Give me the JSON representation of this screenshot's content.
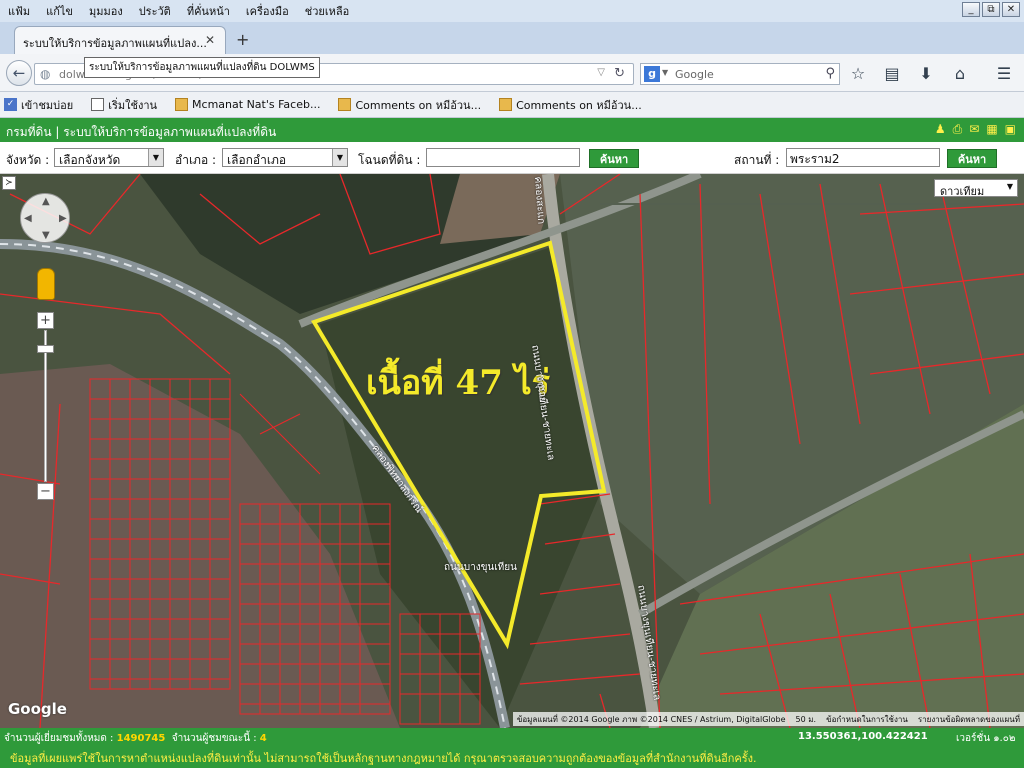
{
  "browser": {
    "menu": [
      "แฟ้ม",
      "แก้ไข",
      "มุมมอง",
      "ประวัติ",
      "ที่คั่นหน้า",
      "เครื่องมือ",
      "ช่วยเหลือ"
    ],
    "window_controls": [
      "_",
      "⧉",
      "✕"
    ],
    "tab_title": "ระบบให้บริการข้อมูลภาพแผนที่แปลง...",
    "tab_tooltip": "ระบบให้บริการข้อมูลภาพแผนที่แปลงที่ดิน DOLWMS",
    "url": "dolwms.dol.go.th/dolwms/",
    "search_placeholder": "Google",
    "bookmarks": [
      "เข้าชมบ่อย",
      "เริ่มใช้งาน",
      "Mcmanat Nat's Faceb...",
      "Comments on หมีอ้วน...",
      "Comments on หมีอ้วน..."
    ]
  },
  "dol": {
    "header_title": "กรมที่ดิน | ระบบให้บริการข้อมูลภาพแผนที่แปลงที่ดิน",
    "province_label": "จังหวัด :",
    "province_value": "เลือกจังหวัด",
    "amphoe_label": "อำเภอ :",
    "amphoe_value": "เลือกอำเภอ",
    "deed_label": "โฉนดที่ดิน :",
    "deed_value": "",
    "search_button": "ค้นหา",
    "place_label": "สถานที่ :",
    "place_value": "พระราม2",
    "search_button_2": "ค้นหา"
  },
  "map": {
    "map_type": "ดาวเทียม",
    "area_annotation": "เนื้อที่ 47 ไร่",
    "road_labels": [
      "ถนนบางขุนเทียน-ชายทะเล",
      "ถนนบางขุนเทียน-ชายทะเล",
      "คลองพิทยาลงกรณ์",
      "ถนนบางขุนเทียน",
      "คลองสะแก",
      "ซ.ชาย"
    ],
    "google_logo": "Google",
    "attribution": [
      "ข้อมูลแผนที่ ©2014 Google ภาพ ©2014 CNES / Astrium, DigitalGlobe",
      "50 ม.",
      "ข้อกำหนดในการใช้งาน",
      "รายงานข้อผิดพลาดของแผนที่"
    ],
    "colors": {
      "parcel_line": "#e8282a",
      "highlight": "#f4ea2a"
    }
  },
  "status": {
    "visitors_label": "จำนวนผู้เยี่ยมชมทั้งหมด :",
    "visitors_count": "1490745",
    "online_label": "จำนวนผู้ชมขณะนี้ :",
    "online_count": "4",
    "coords": "13.550361,100.422421",
    "version": "เวอร์ชั่น ๑.๐๒",
    "disclaimer": "ข้อมูลที่เผยแพร่ใช้ในการหาตำแหน่งแปลงที่ดินเท่านั้น ไม่สามารถใช้เป็นหลักฐานทางกฎหมายได้ กรุณาตรวจสอบความถูกต้องของข้อมูลที่สำนักงานที่ดินอีกครั้ง."
  }
}
